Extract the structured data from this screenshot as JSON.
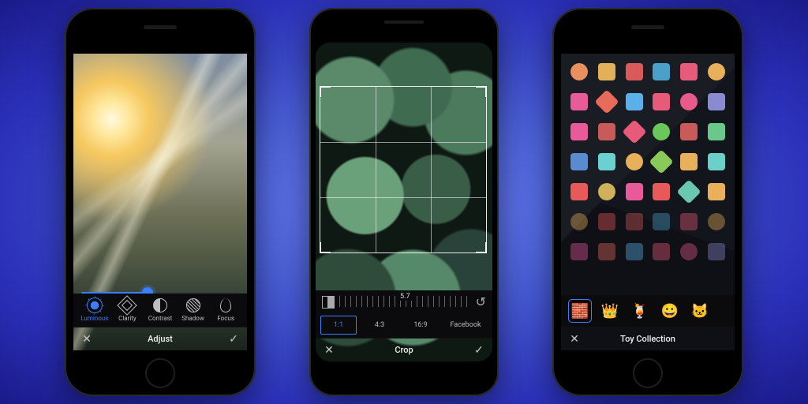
{
  "phone1": {
    "title": "Adjust",
    "close_glyph": "✕",
    "confirm_glyph": "✓",
    "slider_value_pct": 42,
    "tools": [
      {
        "label": "Luminous",
        "icon": "sun-icon",
        "active": true
      },
      {
        "label": "Clarity",
        "icon": "clarity-icon",
        "active": false
      },
      {
        "label": "Contrast",
        "icon": "contrast-icon",
        "active": false
      },
      {
        "label": "Shadow",
        "icon": "shadow-icon",
        "active": false
      },
      {
        "label": "Focus",
        "icon": "focus-icon",
        "active": false
      }
    ]
  },
  "phone2": {
    "title": "Crop",
    "close_glyph": "✕",
    "confirm_glyph": "✓",
    "angle_value": "5.7",
    "reset_glyph": "↺",
    "ratios": [
      {
        "label": "1:1",
        "active": true
      },
      {
        "label": "4:3",
        "active": false
      },
      {
        "label": "16:9",
        "active": false
      },
      {
        "label": "Facebook",
        "active": false
      }
    ]
  },
  "phone3": {
    "title": "Toy Collection",
    "close_glyph": "✕",
    "packs": [
      {
        "name": "blocks-pack",
        "emoji": "🧱",
        "selected": true
      },
      {
        "name": "crown-pack",
        "emoji": "👑",
        "selected": false
      },
      {
        "name": "drink-pack",
        "emoji": "🍹",
        "selected": false
      },
      {
        "name": "smiley-pack",
        "emoji": "😀",
        "selected": false
      },
      {
        "name": "cat-pack",
        "emoji": "🐱",
        "selected": false
      }
    ],
    "sticker_colors": [
      "#e8915e",
      "#e3b05a",
      "#d85a5a",
      "#4aa0c8",
      "#e85a7a",
      "#e8b05a",
      "#e85a9a",
      "#e86a5a",
      "#5ab0e8",
      "#e85a7a",
      "#e85a8a",
      "#8a8ad0",
      "#e85a9a",
      "#c85a5a",
      "#e85a7a",
      "#6ac85a",
      "#c85a5a",
      "#6ac88a",
      "#5a8ad0",
      "#6ad0d0",
      "#e8b05a",
      "#8ac85a",
      "#e8b05a",
      "#6ad0c8",
      "#e85a5a",
      "#d0b05a",
      "#e85a9a",
      "#e85a5a",
      "#6ac8b0",
      "#e8b05a",
      "#e8b05a",
      "#e85a5a",
      "#d85a5a",
      "#4aa0c8",
      "#e85a7a",
      "#e8b05a",
      "#e85a9a",
      "#e86a5a",
      "#5ab0e8",
      "#e85a7a",
      "#e85a8a",
      "#8a8ad0"
    ]
  }
}
